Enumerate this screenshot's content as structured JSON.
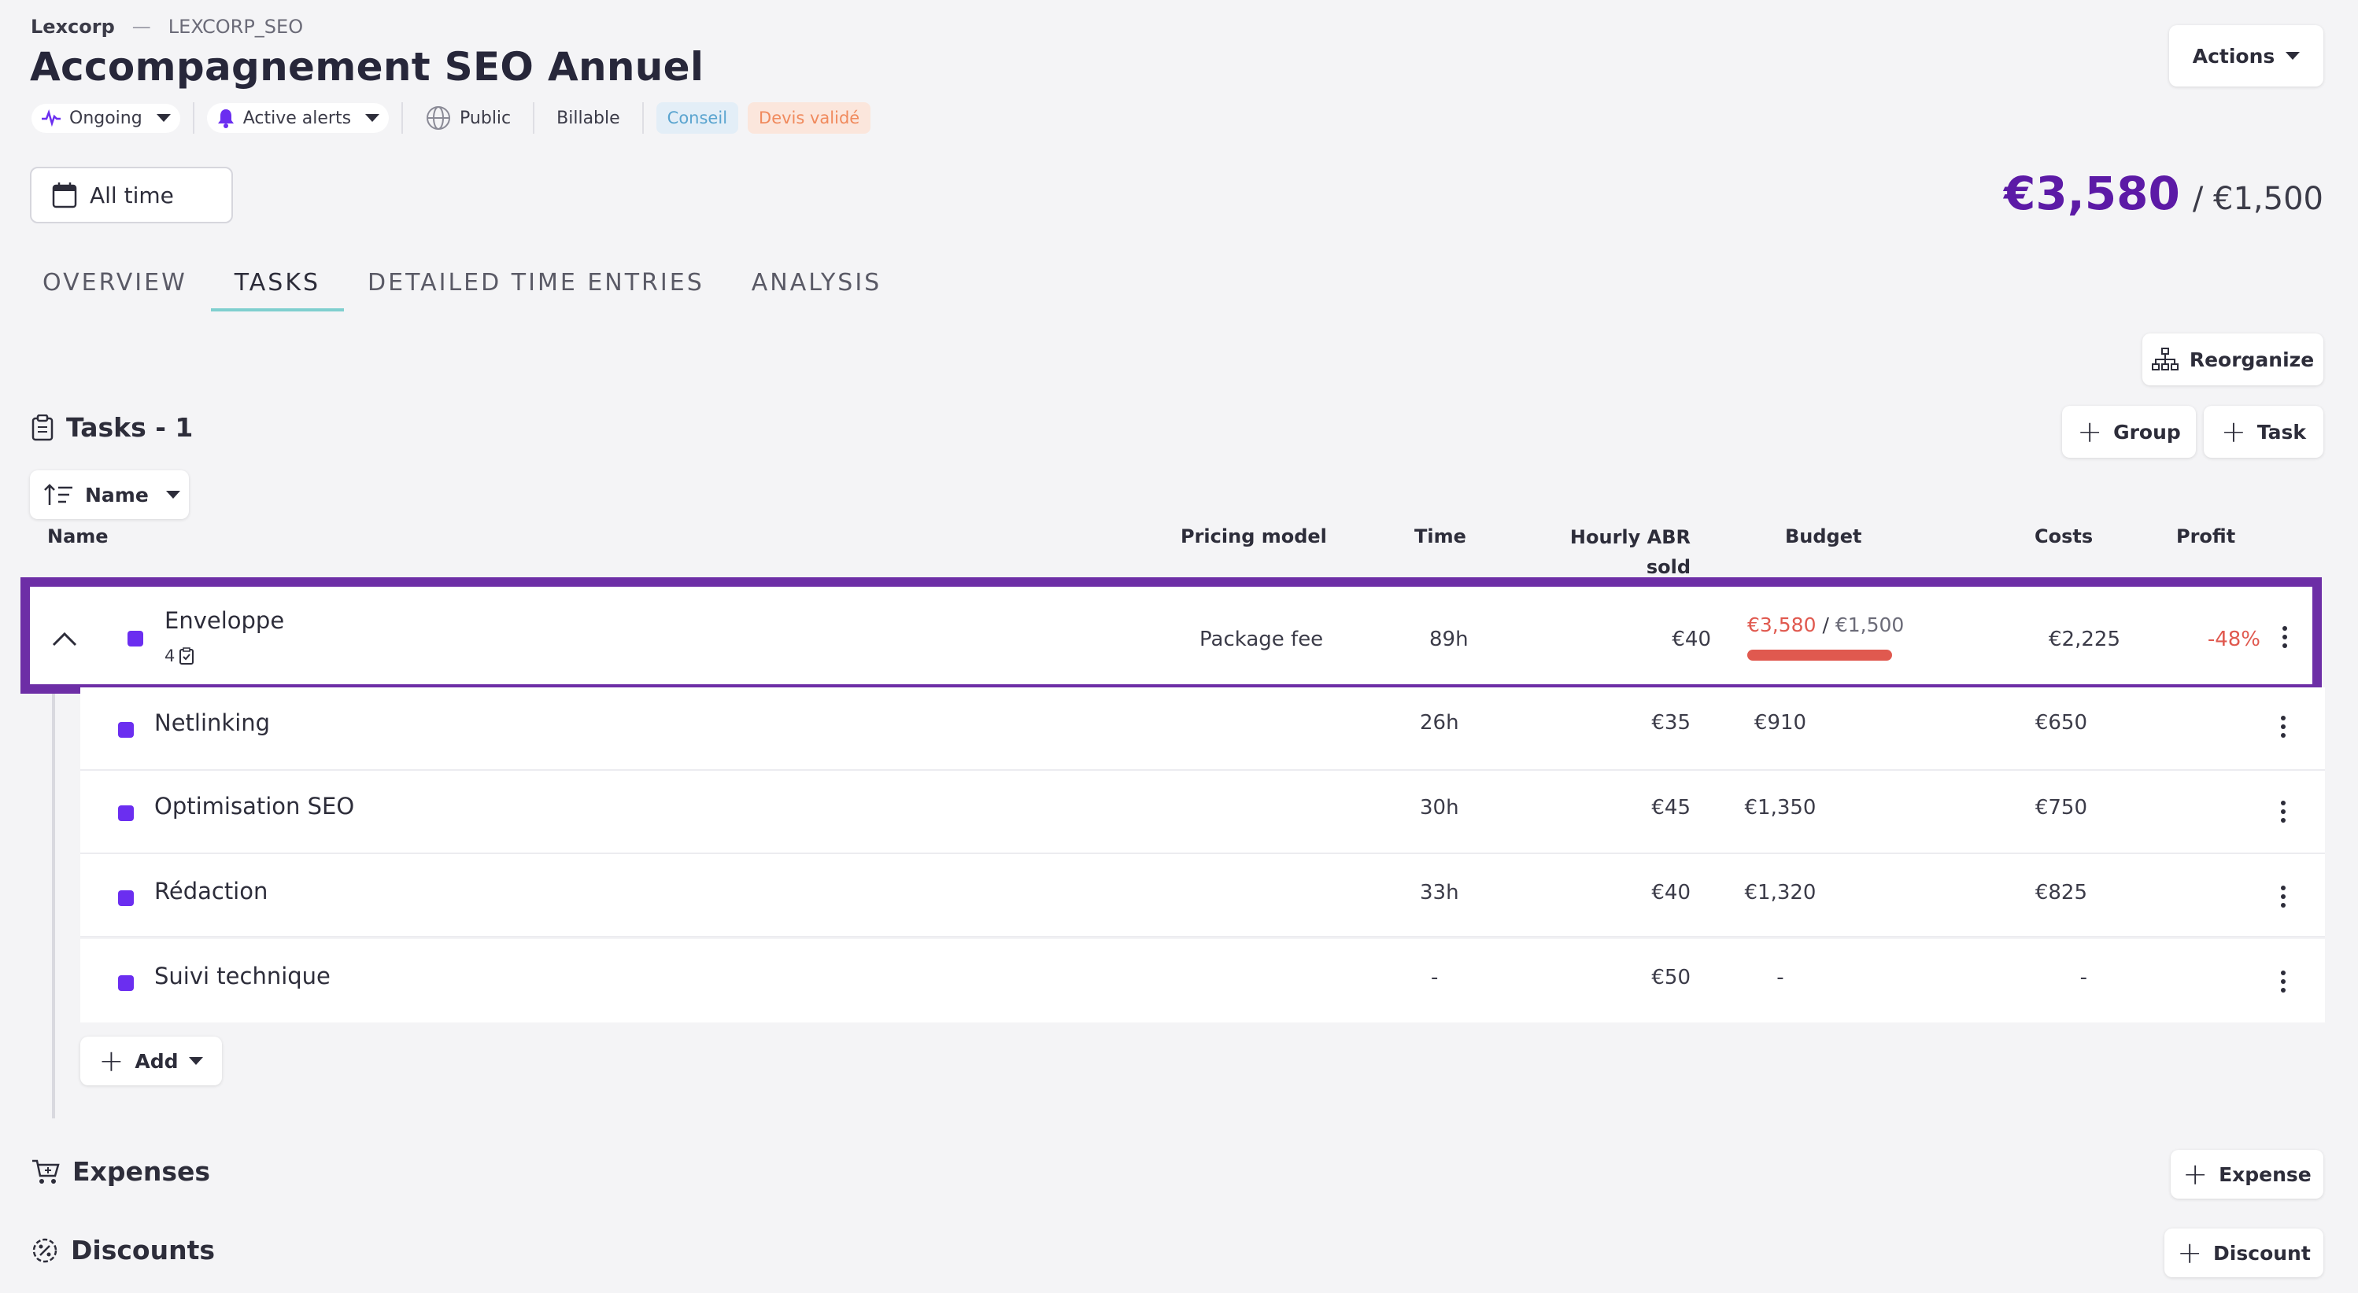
{
  "breadcrumb": {
    "org": "Lexcorp",
    "separator": "—",
    "code": "LEXCORP_SEO"
  },
  "page_title": "Accompagnement SEO Annuel",
  "meta": {
    "status": "Ongoing",
    "alerts": "Active alerts",
    "visibility": "Public",
    "billing": "Billable",
    "tags": [
      "Conseil",
      "Devis validé"
    ]
  },
  "actions_label": "Actions",
  "time_filter": "All time",
  "budget_total": {
    "actual": "€3,580",
    "budget": "/ €1,500"
  },
  "tabs": [
    {
      "label": "OVERVIEW",
      "active": false
    },
    {
      "label": "TASKS",
      "active": true
    },
    {
      "label": "DETAILED TIME ENTRIES",
      "active": false
    },
    {
      "label": "ANALYSIS",
      "active": false
    }
  ],
  "reorganize_label": "Reorganize",
  "tasks_title": "Tasks - 1",
  "group_label": "Group",
  "task_label": "Task",
  "sort_label": "Name",
  "columns": {
    "name": "Name",
    "pricing": "Pricing model",
    "time": "Time",
    "hourly": "Hourly ABR sold",
    "budget": "Budget",
    "costs": "Costs",
    "profit": "Profit"
  },
  "envelope": {
    "name": "Enveloppe",
    "task_count": "4",
    "pricing": "Package fee",
    "time": "89h",
    "hourly": "€40",
    "budget_actual": "€3,580",
    "budget_sep": "/",
    "budget_total": "€1,500",
    "budget_progress": 1.0,
    "costs": "€2,225",
    "profit": "-48%"
  },
  "tasks": [
    {
      "name": "Netlinking",
      "time": "26h",
      "hourly": "€35",
      "budget": "€910",
      "costs": "€650"
    },
    {
      "name": "Optimisation SEO",
      "time": "30h",
      "hourly": "€45",
      "budget": "€1,350",
      "costs": "€750"
    },
    {
      "name": "Rédaction",
      "time": "33h",
      "hourly": "€40",
      "budget": "€1,320",
      "costs": "€825"
    },
    {
      "name": "Suivi technique",
      "time": "-",
      "hourly": "€50",
      "budget": "-",
      "costs": "-"
    }
  ],
  "add_label": "Add",
  "expenses_title": "Expenses",
  "expense_label": "Expense",
  "discounts_title": "Discounts",
  "discount_label": "Discount",
  "colors": {
    "accent": "#5c1aa6",
    "highlight_border": "#6d2ea6",
    "task_dot": "#6b2ef0",
    "negative": "#e0594f",
    "tab_underline": "#7fcfcf"
  }
}
